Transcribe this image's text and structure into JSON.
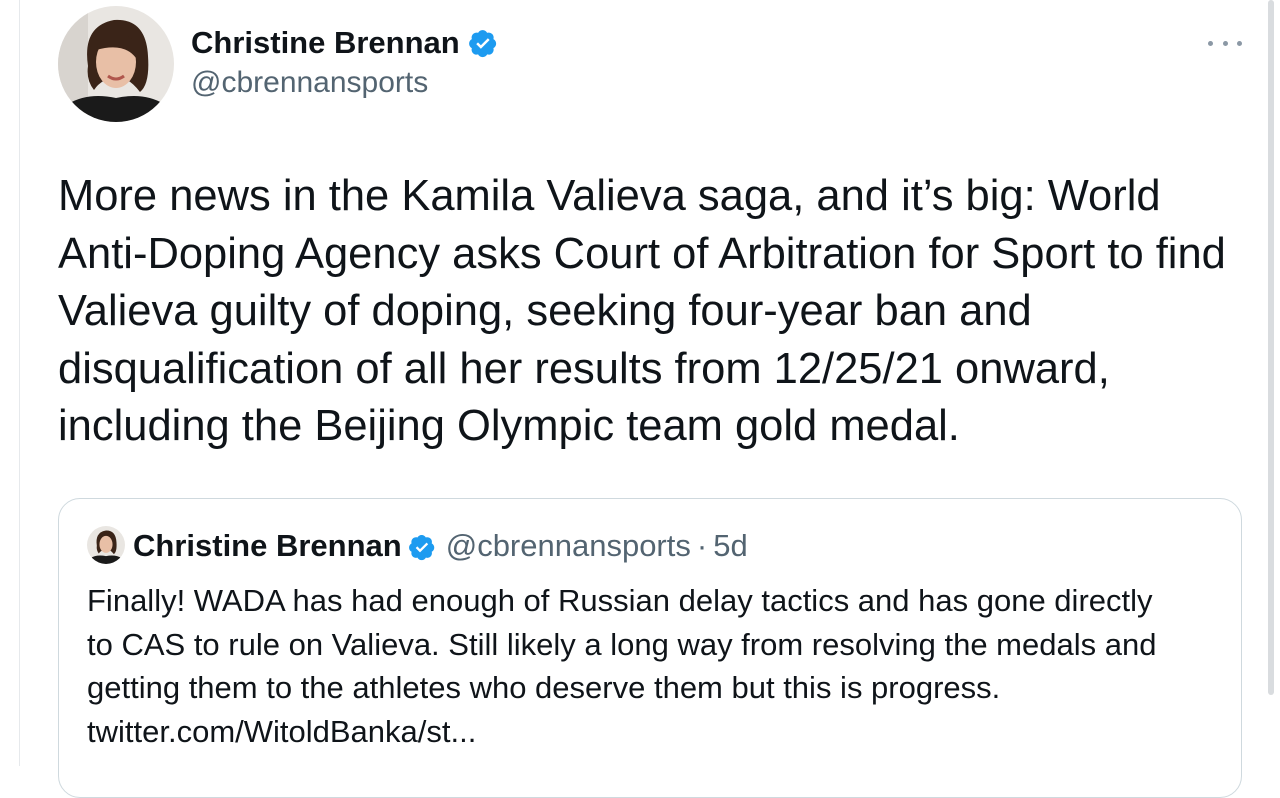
{
  "tweet": {
    "author_name": "Christine Brennan",
    "author_handle": "@cbrennansports",
    "text": "More news in the Kamila Valieva saga, and it’s big: World\nAnti-Doping Agency asks Court of Arbitration for Sport to find\nValieva guilty of doping, seeking four-year ban and\ndisqualification of all her results from 12/25/21 onward,\nincluding the Beijing Olympic team gold medal."
  },
  "quoted_tweet": {
    "author_name": "Christine Brennan",
    "author_handle": "@cbrennansports",
    "separator": "·",
    "time": "5d",
    "text": "Finally! WADA has had enough of Russian delay tactics and has gone directly\nto CAS to rule on Valieva. Still likely a long way from resolving the medals and\ngetting them to the athletes who deserve them but this is progress.\ntwitter.com/WitoldBanka/st..."
  },
  "icons": {
    "verified": "verified-badge-icon",
    "more": "more-options-icon"
  },
  "colors": {
    "verified_blue": "#1d9bf0",
    "text": "#0f1419",
    "secondary_text": "#536471",
    "border": "#cfd9de"
  }
}
